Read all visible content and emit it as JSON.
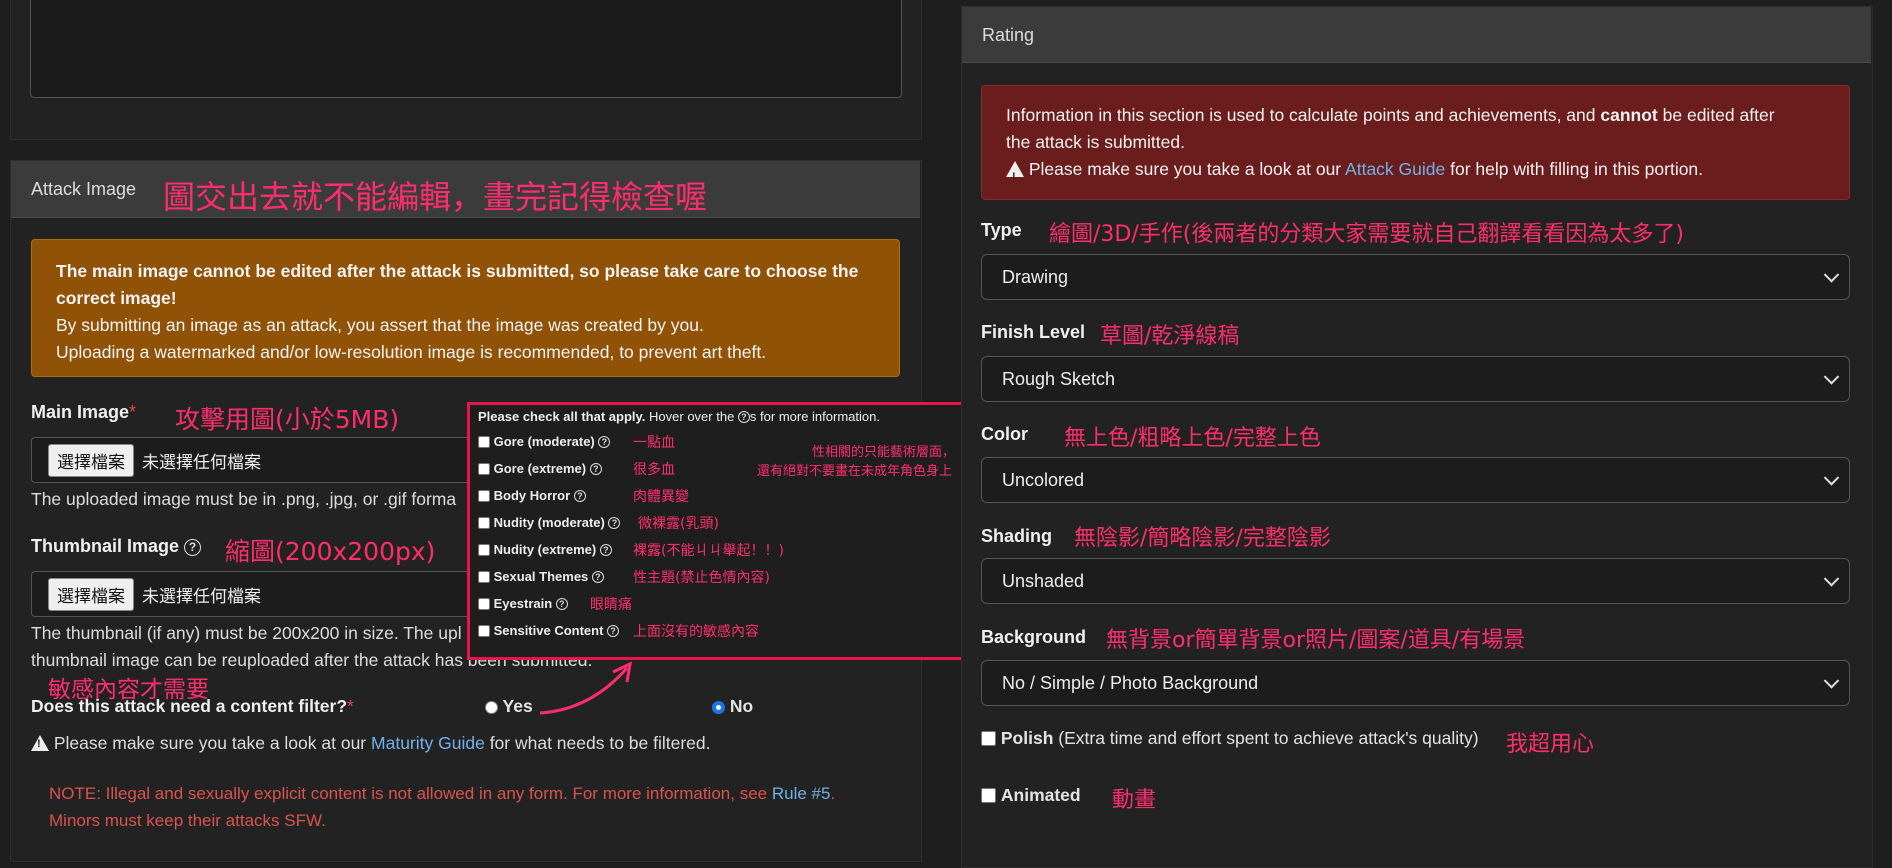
{
  "left": {
    "attack_image_header": "Attack Image",
    "attack_image_anno": "圖交出去就不能編輯，畫完記得檢查喔",
    "warning_bold": "The main image cannot be edited after the attack is submitted, so please take care to choose the correct image!",
    "warning_line1": "By submitting an image as an attack, you assert that the image was created by you.",
    "warning_line2": "Uploading a watermarked and/or low-resolution image is recommended, to prevent art theft.",
    "main_image_label": "Main Image",
    "required_mark": "*",
    "main_image_anno": "攻擊用圖(小於5MB)",
    "file_button": "選擇檔案",
    "file_none": "未選擇任何檔案",
    "main_image_help": "The uploaded image must be in .png, .jpg, or .gif forma",
    "thumb_label": "Thumbnail Image",
    "thumb_anno": "縮圖(200x200px)",
    "thumb_help1": "The thumbnail (if any) must be 200x200 in size. The upl",
    "thumb_help2": "thumbnail image can be reuploaded after the attack has been submitted.",
    "filter_anno": "敏感內容才需要",
    "filter_label": "Does this attack need a content filter?",
    "yes": "Yes",
    "no": "No",
    "maturity_pre": "Please make sure you take a look at our",
    "maturity_link": "Maturity Guide",
    "maturity_post": "for what needs to be filtered.",
    "note_pre": "NOTE: Illegal and sexually explicit content is not allowed in any form. For more information, see",
    "note_link": "Rule #5",
    "note_dot": ".",
    "note_line2": "Minors must keep their attacks SFW."
  },
  "popup": {
    "intro_bold": "Please check all that apply.",
    "intro_pre": "Hover over the",
    "intro_post": "s for more information.",
    "side_note1": "性相關的只能藝術層面，",
    "side_note2": "還有絕對不要畫在未成年角色身上",
    "items": [
      {
        "label": "Gore (moderate)",
        "anno": "一點血"
      },
      {
        "label": "Gore (extreme)",
        "anno": "很多血"
      },
      {
        "label": "Body Horror",
        "anno": "肉體異變"
      },
      {
        "label": "Nudity (moderate)",
        "anno": "微裸露(乳頭)"
      },
      {
        "label": "Nudity (extreme)",
        "anno": "裸露(不能ㄐㄐ舉起！！)"
      },
      {
        "label": "Sexual Themes",
        "anno": "性主題(禁止色情內容)"
      },
      {
        "label": "Eyestrain",
        "anno": "眼睛痛"
      },
      {
        "label": "Sensitive Content",
        "anno": "上面沒有的敏感內容"
      }
    ]
  },
  "right": {
    "header": "Rating",
    "info_pre": "Information in this section is used to calculate points and achievements, and",
    "info_bold": "cannot",
    "info_post": "be edited after",
    "info_line2": "the attack is submitted.",
    "guide_pre": "Please make sure you take a look at our",
    "guide_link": "Attack Guide",
    "guide_post": "for help with filling in this portion.",
    "type_label": "Type",
    "type_anno": "繪圖/3D/手作(後兩者的分類大家需要就自己翻譯看看因為太多了)",
    "type_value": "Drawing",
    "finish_label": "Finish Level",
    "finish_anno": "草圖/乾淨線稿",
    "finish_value": "Rough Sketch",
    "color_label": "Color",
    "color_anno": "無上色/粗略上色/完整上色",
    "color_value": "Uncolored",
    "shading_label": "Shading",
    "shading_anno": "無陰影/簡略陰影/完整陰影",
    "shading_value": "Unshaded",
    "bg_label": "Background",
    "bg_anno": "無背景or簡單背景or照片/圖案/道具/有場景",
    "bg_value": "No / Simple / Photo Background",
    "polish_label": "Polish",
    "polish_desc": "(Extra time and effort spent to achieve attack's quality)",
    "polish_anno": "我超用心",
    "animated_label": "Animated",
    "animated_anno": "動畫"
  },
  "colors": {
    "annotation": "#ff2d6f",
    "warning_bg": "#8f5207",
    "danger_bg": "#6b1c1c",
    "link": "#6fb3e8",
    "note_text": "#d9534f"
  }
}
